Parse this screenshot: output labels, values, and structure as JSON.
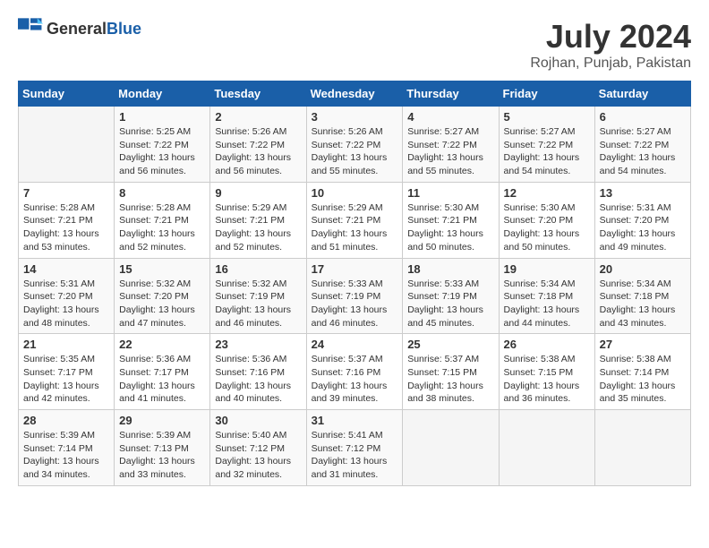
{
  "header": {
    "logo_general": "General",
    "logo_blue": "Blue",
    "title": "July 2024",
    "subtitle": "Rojhan, Punjab, Pakistan"
  },
  "weekdays": [
    "Sunday",
    "Monday",
    "Tuesday",
    "Wednesday",
    "Thursday",
    "Friday",
    "Saturday"
  ],
  "weeks": [
    [
      {
        "day": "",
        "sunrise": "",
        "sunset": "",
        "daylight": ""
      },
      {
        "day": "1",
        "sunrise": "Sunrise: 5:25 AM",
        "sunset": "Sunset: 7:22 PM",
        "daylight": "Daylight: 13 hours and 56 minutes."
      },
      {
        "day": "2",
        "sunrise": "Sunrise: 5:26 AM",
        "sunset": "Sunset: 7:22 PM",
        "daylight": "Daylight: 13 hours and 56 minutes."
      },
      {
        "day": "3",
        "sunrise": "Sunrise: 5:26 AM",
        "sunset": "Sunset: 7:22 PM",
        "daylight": "Daylight: 13 hours and 55 minutes."
      },
      {
        "day": "4",
        "sunrise": "Sunrise: 5:27 AM",
        "sunset": "Sunset: 7:22 PM",
        "daylight": "Daylight: 13 hours and 55 minutes."
      },
      {
        "day": "5",
        "sunrise": "Sunrise: 5:27 AM",
        "sunset": "Sunset: 7:22 PM",
        "daylight": "Daylight: 13 hours and 54 minutes."
      },
      {
        "day": "6",
        "sunrise": "Sunrise: 5:27 AM",
        "sunset": "Sunset: 7:22 PM",
        "daylight": "Daylight: 13 hours and 54 minutes."
      }
    ],
    [
      {
        "day": "7",
        "sunrise": "Sunrise: 5:28 AM",
        "sunset": "Sunset: 7:21 PM",
        "daylight": "Daylight: 13 hours and 53 minutes."
      },
      {
        "day": "8",
        "sunrise": "Sunrise: 5:28 AM",
        "sunset": "Sunset: 7:21 PM",
        "daylight": "Daylight: 13 hours and 52 minutes."
      },
      {
        "day": "9",
        "sunrise": "Sunrise: 5:29 AM",
        "sunset": "Sunset: 7:21 PM",
        "daylight": "Daylight: 13 hours and 52 minutes."
      },
      {
        "day": "10",
        "sunrise": "Sunrise: 5:29 AM",
        "sunset": "Sunset: 7:21 PM",
        "daylight": "Daylight: 13 hours and 51 minutes."
      },
      {
        "day": "11",
        "sunrise": "Sunrise: 5:30 AM",
        "sunset": "Sunset: 7:21 PM",
        "daylight": "Daylight: 13 hours and 50 minutes."
      },
      {
        "day": "12",
        "sunrise": "Sunrise: 5:30 AM",
        "sunset": "Sunset: 7:20 PM",
        "daylight": "Daylight: 13 hours and 50 minutes."
      },
      {
        "day": "13",
        "sunrise": "Sunrise: 5:31 AM",
        "sunset": "Sunset: 7:20 PM",
        "daylight": "Daylight: 13 hours and 49 minutes."
      }
    ],
    [
      {
        "day": "14",
        "sunrise": "Sunrise: 5:31 AM",
        "sunset": "Sunset: 7:20 PM",
        "daylight": "Daylight: 13 hours and 48 minutes."
      },
      {
        "day": "15",
        "sunrise": "Sunrise: 5:32 AM",
        "sunset": "Sunset: 7:20 PM",
        "daylight": "Daylight: 13 hours and 47 minutes."
      },
      {
        "day": "16",
        "sunrise": "Sunrise: 5:32 AM",
        "sunset": "Sunset: 7:19 PM",
        "daylight": "Daylight: 13 hours and 46 minutes."
      },
      {
        "day": "17",
        "sunrise": "Sunrise: 5:33 AM",
        "sunset": "Sunset: 7:19 PM",
        "daylight": "Daylight: 13 hours and 46 minutes."
      },
      {
        "day": "18",
        "sunrise": "Sunrise: 5:33 AM",
        "sunset": "Sunset: 7:19 PM",
        "daylight": "Daylight: 13 hours and 45 minutes."
      },
      {
        "day": "19",
        "sunrise": "Sunrise: 5:34 AM",
        "sunset": "Sunset: 7:18 PM",
        "daylight": "Daylight: 13 hours and 44 minutes."
      },
      {
        "day": "20",
        "sunrise": "Sunrise: 5:34 AM",
        "sunset": "Sunset: 7:18 PM",
        "daylight": "Daylight: 13 hours and 43 minutes."
      }
    ],
    [
      {
        "day": "21",
        "sunrise": "Sunrise: 5:35 AM",
        "sunset": "Sunset: 7:17 PM",
        "daylight": "Daylight: 13 hours and 42 minutes."
      },
      {
        "day": "22",
        "sunrise": "Sunrise: 5:36 AM",
        "sunset": "Sunset: 7:17 PM",
        "daylight": "Daylight: 13 hours and 41 minutes."
      },
      {
        "day": "23",
        "sunrise": "Sunrise: 5:36 AM",
        "sunset": "Sunset: 7:16 PM",
        "daylight": "Daylight: 13 hours and 40 minutes."
      },
      {
        "day": "24",
        "sunrise": "Sunrise: 5:37 AM",
        "sunset": "Sunset: 7:16 PM",
        "daylight": "Daylight: 13 hours and 39 minutes."
      },
      {
        "day": "25",
        "sunrise": "Sunrise: 5:37 AM",
        "sunset": "Sunset: 7:15 PM",
        "daylight": "Daylight: 13 hours and 38 minutes."
      },
      {
        "day": "26",
        "sunrise": "Sunrise: 5:38 AM",
        "sunset": "Sunset: 7:15 PM",
        "daylight": "Daylight: 13 hours and 36 minutes."
      },
      {
        "day": "27",
        "sunrise": "Sunrise: 5:38 AM",
        "sunset": "Sunset: 7:14 PM",
        "daylight": "Daylight: 13 hours and 35 minutes."
      }
    ],
    [
      {
        "day": "28",
        "sunrise": "Sunrise: 5:39 AM",
        "sunset": "Sunset: 7:14 PM",
        "daylight": "Daylight: 13 hours and 34 minutes."
      },
      {
        "day": "29",
        "sunrise": "Sunrise: 5:39 AM",
        "sunset": "Sunset: 7:13 PM",
        "daylight": "Daylight: 13 hours and 33 minutes."
      },
      {
        "day": "30",
        "sunrise": "Sunrise: 5:40 AM",
        "sunset": "Sunset: 7:12 PM",
        "daylight": "Daylight: 13 hours and 32 minutes."
      },
      {
        "day": "31",
        "sunrise": "Sunrise: 5:41 AM",
        "sunset": "Sunset: 7:12 PM",
        "daylight": "Daylight: 13 hours and 31 minutes."
      },
      {
        "day": "",
        "sunrise": "",
        "sunset": "",
        "daylight": ""
      },
      {
        "day": "",
        "sunrise": "",
        "sunset": "",
        "daylight": ""
      },
      {
        "day": "",
        "sunrise": "",
        "sunset": "",
        "daylight": ""
      }
    ]
  ]
}
